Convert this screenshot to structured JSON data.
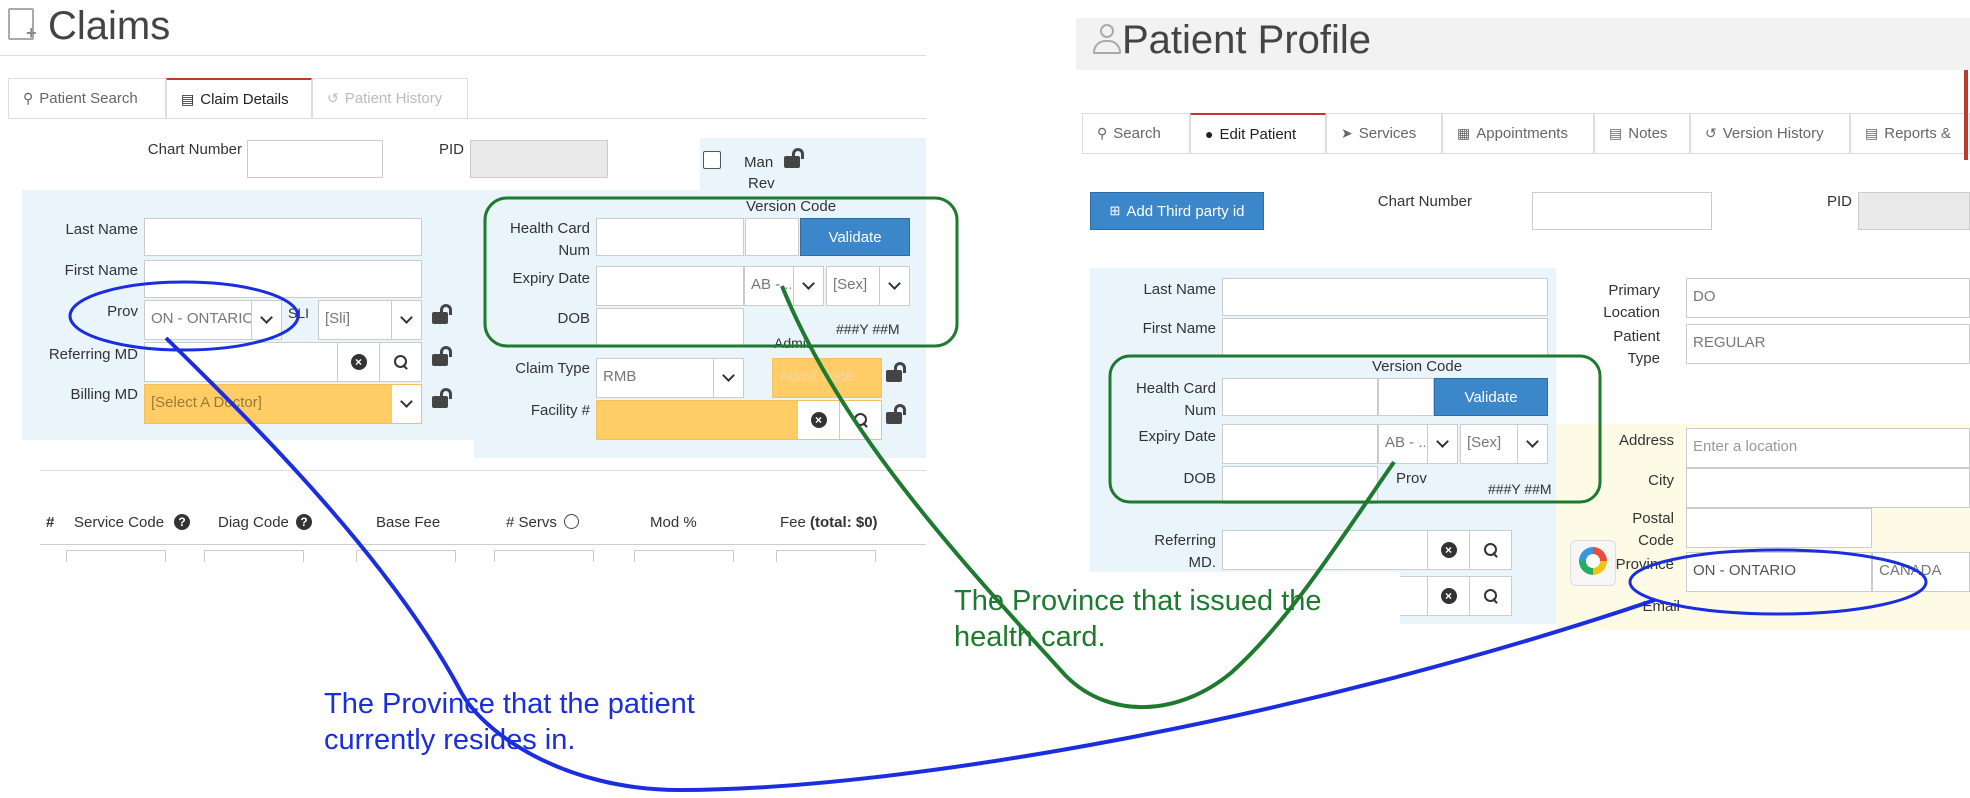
{
  "colors": {
    "annotation_blue": "#1a2ee0",
    "annotation_green": "#1e7a2e",
    "panel_blue": "#eaf4fb",
    "required_yellow": "#ffcc66",
    "validate_blue": "#3b87c9",
    "tab_active_accent": "#c0392b"
  },
  "claims": {
    "title": "Claims",
    "tabs": [
      {
        "label": "Patient Search",
        "icon": "search-icon"
      },
      {
        "label": "Claim Details",
        "icon": "document-icon"
      },
      {
        "label": "Patient History",
        "icon": "history-icon"
      }
    ],
    "chart_number_label": "Chart Number",
    "pid_label": "PID",
    "man_rev_label": "Man",
    "man_rev_label2": "Rev",
    "last_name_label": "Last Name",
    "first_name_label": "First Name",
    "prov_label": "Prov",
    "prov_value": "ON - ONTARIO",
    "sli_label": "SLI",
    "sli_value": "[Sli]",
    "referring_label": "Referring MD",
    "billing_label": "Billing MD",
    "billing_value": "[Select A Doctor]",
    "version_code_label": "Version Code",
    "health_card_label": "Health Card",
    "health_card_label2": "Num",
    "validate_label": "Validate",
    "expiry_label": "Expiry Date",
    "expiry_prov_value": "AB - ...",
    "sex_value": "[Sex]",
    "dob_label": "DOB",
    "dob_hint": "###Y ##M",
    "claim_type_label": "Claim Type",
    "claim_type_value": "RMB",
    "admit_label": "Admit",
    "admit_placeholder": "Admit Date",
    "facility_label": "Facility #",
    "columns": [
      "#",
      "Service Code",
      "Diag Code",
      "Base Fee",
      "# Servs",
      "Mod %",
      "Fee"
    ],
    "fee_total": "(total: $0)"
  },
  "profile": {
    "title": "Patient Profile",
    "tabs": [
      {
        "label": "Search",
        "icon": "search-icon"
      },
      {
        "label": "Edit Patient",
        "icon": "user-icon"
      },
      {
        "label": "Services",
        "icon": "send-icon"
      },
      {
        "label": "Appointments",
        "icon": "calendar-icon"
      },
      {
        "label": "Notes",
        "icon": "notes-icon"
      },
      {
        "label": "Version History",
        "icon": "history-icon"
      },
      {
        "label": "Reports &",
        "icon": "report-icon"
      }
    ],
    "add_third_party": "Add Third party id",
    "chart_number_label": "Chart Number",
    "pid_label": "PID",
    "last_name_label": "Last Name",
    "first_name_label": "First Name",
    "version_code_label": "Version Code",
    "health_card_label": "Health Card",
    "health_card_label2": "Num",
    "validate_label": "Validate",
    "expiry_label": "Expiry Date",
    "expiry_prov_value": "AB - ...",
    "sex_value": "[Sex]",
    "dob_label": "DOB",
    "prov_label": "Prov",
    "dob_hint": "###Y ##M",
    "referring_label": "Referring",
    "referring_label2": "MD.",
    "primary_location_label": "Primary",
    "primary_location_label2": "Location",
    "primary_location_value": "DO",
    "patient_type_label": "Patient",
    "patient_type_label2": "Type",
    "patient_type_value": "REGULAR",
    "address_label": "Address",
    "address_placeholder": "Enter a location",
    "city_label": "City",
    "postal_label": "Postal",
    "postal_label2": "Code",
    "province_label": "Province",
    "province_value": "ON - ONTARIO",
    "country_value": "CANADA",
    "email_label": "Email"
  },
  "annotations": {
    "green_text": "The Province that issued the health card.",
    "blue_text": "The Province that the patient currently resides in."
  }
}
